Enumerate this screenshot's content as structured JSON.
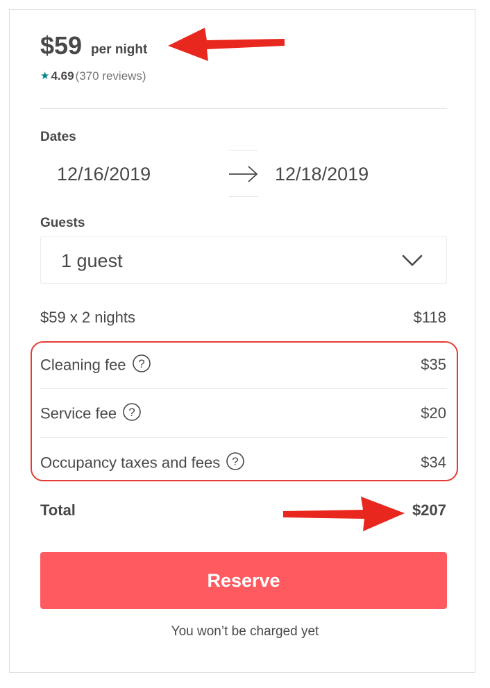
{
  "price": {
    "amount": "$59",
    "unit": "per night"
  },
  "rating": {
    "score": "4.69",
    "reviews": "(370 reviews)"
  },
  "dates": {
    "label": "Dates",
    "check_in": "12/16/2019",
    "check_out": "12/18/2019"
  },
  "guests": {
    "label": "Guests",
    "value": "1 guest"
  },
  "breakdown": {
    "nights": {
      "label": "$59 x 2 nights",
      "amount": "$118"
    },
    "fees": [
      {
        "label": "Cleaning fee",
        "amount": "$35"
      },
      {
        "label": "Service fee",
        "amount": "$20"
      },
      {
        "label": "Occupancy taxes and fees",
        "amount": "$34"
      }
    ],
    "total": {
      "label": "Total",
      "amount": "$207"
    }
  },
  "reserve_button": "Reserve",
  "note": "You won’t be charged yet",
  "colors": {
    "accent": "#ff5a5f",
    "star": "#008489",
    "annotation": "#e33b33"
  }
}
